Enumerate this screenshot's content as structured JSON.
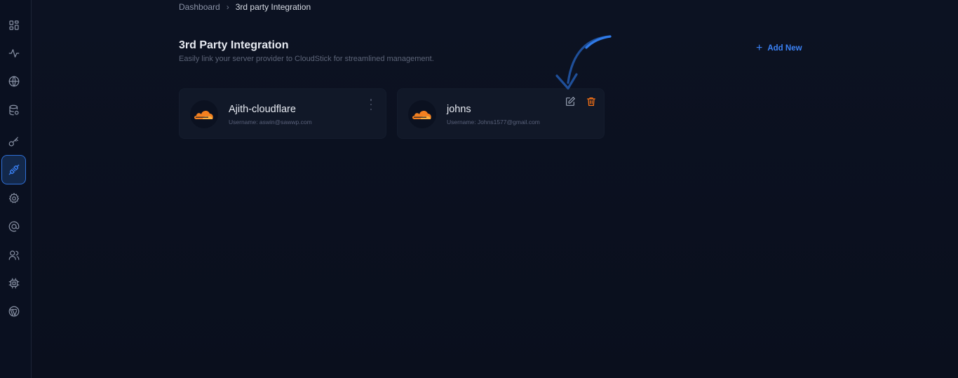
{
  "breadcrumb": {
    "home": "Dashboard",
    "separator": "›",
    "current": "3rd party Integration"
  },
  "header": {
    "title": "3rd Party Integration",
    "subtitle": "Easily link your server provider to CloudStick for streamlined management.",
    "add_new_label": "Add New"
  },
  "sidebar": {
    "items": [
      {
        "icon": "grid-icon"
      },
      {
        "icon": "activity-icon"
      },
      {
        "icon": "globe-icon"
      },
      {
        "icon": "database-icon"
      },
      {
        "icon": "key-icon"
      },
      {
        "icon": "plug-icon",
        "active": true
      },
      {
        "icon": "gear-icon"
      },
      {
        "icon": "at-sign-icon"
      },
      {
        "icon": "users-icon"
      },
      {
        "icon": "cpu-icon"
      },
      {
        "icon": "wordpress-icon"
      }
    ]
  },
  "integrations": [
    {
      "name": "Ajith-cloudflare",
      "username": "Username: aswin@sawwp.com",
      "provider": "cloudflare-icon"
    },
    {
      "name": "johns",
      "username": "Username: Johns1577@gmail.com",
      "provider": "cloudflare-icon"
    }
  ],
  "colors": {
    "accent": "#3b82f6",
    "cloudflare": "#f38020",
    "delete": "#f97316",
    "background": "#0b1120",
    "card": "#111828"
  }
}
